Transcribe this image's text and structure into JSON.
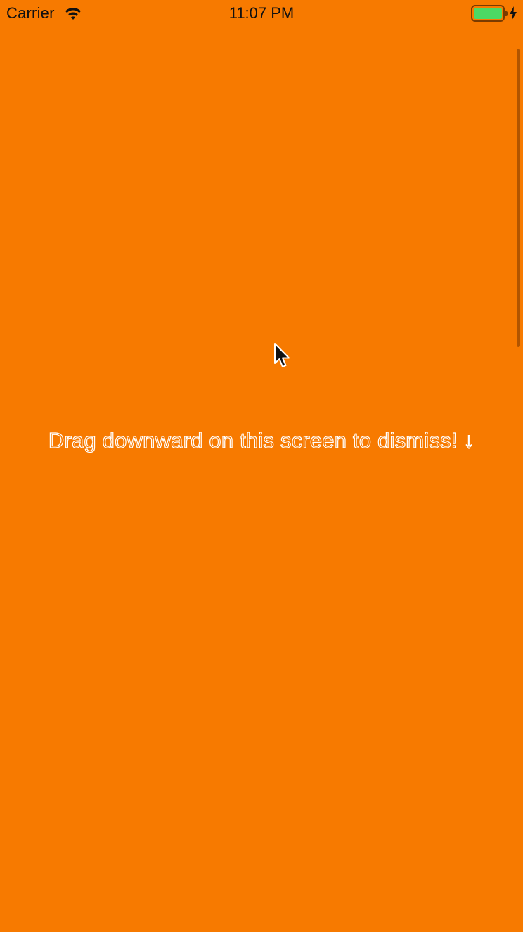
{
  "status_bar": {
    "carrier": "Carrier",
    "time": "11:07 PM",
    "battery_color": "#4CD964",
    "icons": [
      "wifi-icon",
      "battery-icon",
      "charging-bolt-icon"
    ]
  },
  "screen": {
    "background_color": "#F77A00",
    "instruction": "Drag downward on this screen to dismiss! ↓"
  },
  "cursor": {
    "icon": "arrow-cursor-icon"
  }
}
